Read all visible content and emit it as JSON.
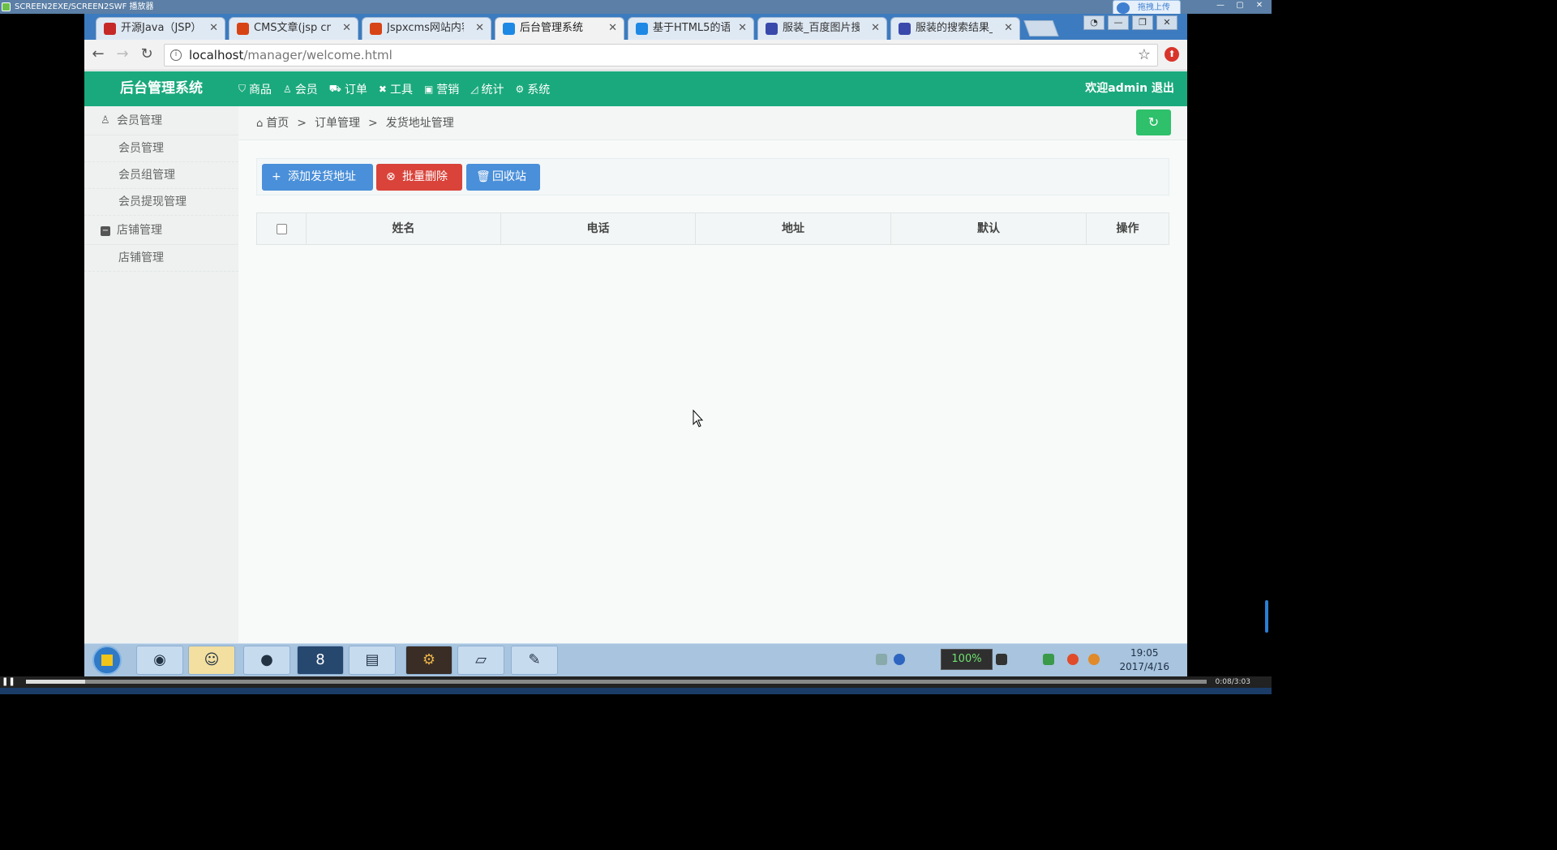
{
  "player": {
    "title": "SCREEN2EXE/SCREEN2SWF 播放器",
    "upload_chip": "拖拽上传",
    "time": "0:08/3:03",
    "progress": 0.05
  },
  "browser": {
    "tabs": [
      {
        "label": "开源Java（JSP）",
        "icon_color": "#c62828"
      },
      {
        "label": "CMS文章(jsp cm",
        "icon_color": "#d84315"
      },
      {
        "label": "Jspxcms网站内容",
        "icon_color": "#d84315"
      },
      {
        "label": "后台管理系统",
        "icon_color": "#1e88e5"
      },
      {
        "label": "基于HTML5的语",
        "icon_color": "#1e88e5"
      },
      {
        "label": "服装_百度图片搜",
        "icon_color": "#3949ab"
      },
      {
        "label": "服装的搜索结果_",
        "icon_color": "#3949ab"
      }
    ],
    "url_host": "localhost",
    "url_path": "/manager/welcome.html"
  },
  "app": {
    "brand": "后台管理系统",
    "nav": [
      {
        "label": "商品",
        "icon": "bag-icon"
      },
      {
        "label": "会员",
        "icon": "user-icon"
      },
      {
        "label": "订单",
        "icon": "cart-icon"
      },
      {
        "label": "工具",
        "icon": "tools-icon"
      },
      {
        "label": "营销",
        "icon": "gift-icon"
      },
      {
        "label": "统计",
        "icon": "chart-icon"
      },
      {
        "label": "系统",
        "icon": "gear-icon"
      }
    ],
    "user_greeting": "欢迎admin 退出"
  },
  "sidebar": {
    "groups": [
      {
        "label": "会员管理",
        "items": [
          "会员管理",
          "会员组管理",
          "会员提现管理"
        ]
      },
      {
        "label": "店铺管理",
        "items": [
          "店铺管理"
        ]
      }
    ]
  },
  "breadcrumb": {
    "home": "首页",
    "sep": ">",
    "level1": "订单管理",
    "level2": "发货地址管理"
  },
  "actions": {
    "add": "添加发货地址",
    "batch_delete": "批量删除",
    "recycle": "回收站"
  },
  "table": {
    "columns": [
      "姓名",
      "电话",
      "地址",
      "默认",
      "操作"
    ]
  },
  "taskbar": {
    "battery": "100%",
    "time": "19:05",
    "date": "2017/4/16"
  }
}
